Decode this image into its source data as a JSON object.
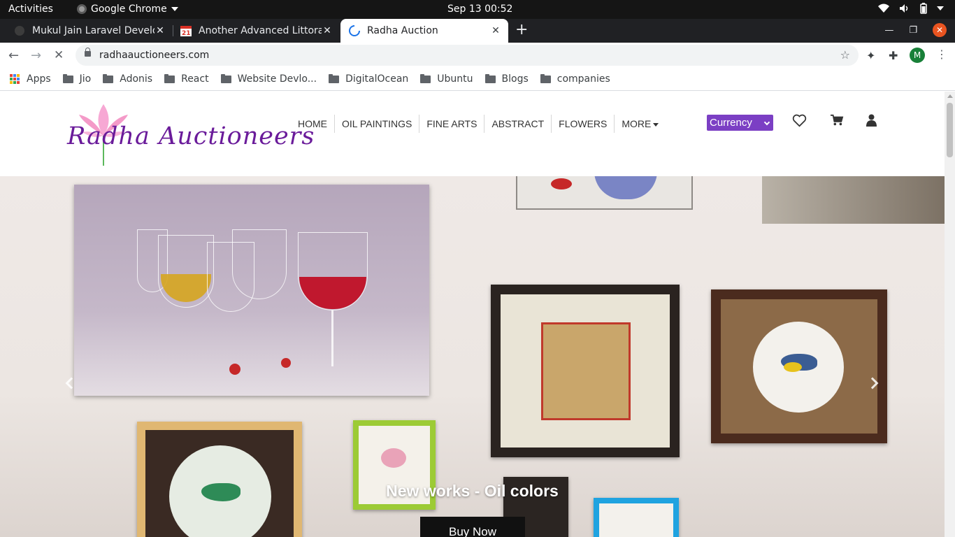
{
  "system_bar": {
    "activities": "Activities",
    "app_name": "Google Chrome",
    "clock": "Sep 13  00:52"
  },
  "tabs": [
    {
      "title": "Mukul Jain Laravel Develo",
      "close": "✕"
    },
    {
      "title": "Another Advanced Littora",
      "close": "✕"
    },
    {
      "title": "Radha Auction",
      "close": "✕"
    }
  ],
  "new_tab": "+",
  "address": {
    "url": "radhaauctioneers.com"
  },
  "profile_initial": "M",
  "bookmarks": [
    "Apps",
    "Jio",
    "Adonis",
    "React",
    "Website Devlo...",
    "DigitalOcean",
    "Ubuntu",
    "Blogs",
    "companies"
  ],
  "site": {
    "logo_text": "Radha Auctioneers",
    "menu": [
      "HOME",
      "OIL PAINTINGS",
      "FINE ARTS",
      "ABSTRACT",
      "FLOWERS"
    ],
    "menu_more": "MORE",
    "currency_label": "Currency",
    "icons": [
      "heart-icon",
      "cart-icon",
      "user-icon"
    ]
  },
  "hero": {
    "caption": "New works - Oil colors",
    "button": "Buy Now"
  },
  "colors": {
    "brand_purple": "#7b3fc4",
    "logo_purple": "#6a1b9a",
    "tab_active": "#ffffff",
    "tab_strip": "#202124"
  }
}
